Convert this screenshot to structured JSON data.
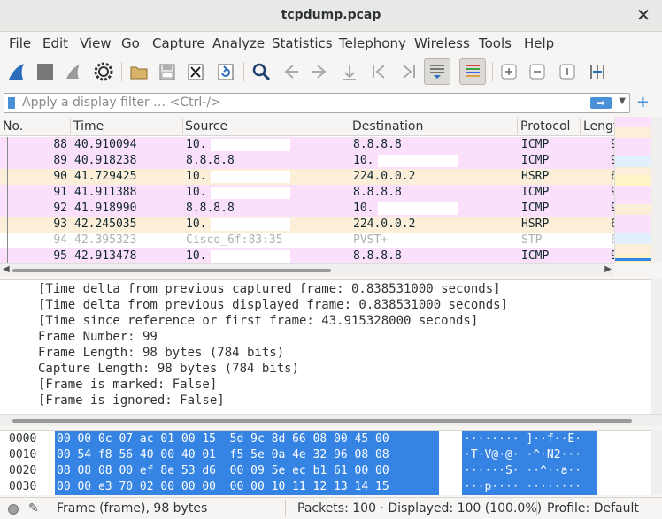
{
  "window": {
    "title": "tcpdump.pcap",
    "close": "✕"
  },
  "menu": [
    "File",
    "Edit",
    "View",
    "Go",
    "Capture",
    "Analyze",
    "Statistics",
    "Telephony",
    "Wireless",
    "Tools",
    "Help"
  ],
  "filter": {
    "placeholder": "Apply a display filter … <Ctrl-/>",
    "apply": "➡",
    "add": "+"
  },
  "columns": [
    "No.",
    "Time",
    "Source",
    "Destination",
    "Protocol",
    "Lengt"
  ],
  "packets": [
    {
      "no": "88",
      "time": "40.910094",
      "src": "10.",
      "dst": "8.8.8.8",
      "proto": "ICMP",
      "len": "9",
      "bg": "#fae0fa",
      "fg": "#12272e"
    },
    {
      "no": "89",
      "time": "40.918238",
      "src": "8.8.8.8",
      "dst": "10.",
      "proto": "ICMP",
      "len": "9",
      "bg": "#fae0fa",
      "fg": "#12272e"
    },
    {
      "no": "90",
      "time": "41.729425",
      "src": "10.",
      "dst": "224.0.0.2",
      "proto": "HSRP",
      "len": "6",
      "bg": "#fcefd9",
      "fg": "#12272e"
    },
    {
      "no": "91",
      "time": "41.911388",
      "src": "10.",
      "dst": "8.8.8.8",
      "proto": "ICMP",
      "len": "9",
      "bg": "#fae0fa",
      "fg": "#12272e"
    },
    {
      "no": "92",
      "time": "41.918990",
      "src": "8.8.8.8",
      "dst": "10.",
      "proto": "ICMP",
      "len": "9",
      "bg": "#fae0fa",
      "fg": "#12272e"
    },
    {
      "no": "93",
      "time": "42.245035",
      "src": "10.",
      "dst": "224.0.0.2",
      "proto": "HSRP",
      "len": "6",
      "bg": "#fcefd9",
      "fg": "#12272e"
    },
    {
      "no": "94",
      "time": "42.395323",
      "src": "Cisco_6f:83:35",
      "dst": "PVST+",
      "proto": "STP",
      "len": "6",
      "bg": "#ffffff",
      "fg": "#b0b0b0"
    },
    {
      "no": "95",
      "time": "42.913478",
      "src": "10.",
      "dst": "8.8.8.8",
      "proto": "ICMP",
      "len": "9",
      "bg": "#fae0fa",
      "fg": "#12272e"
    }
  ],
  "details": [
    "[Time delta from previous captured frame: 0.838531000 seconds]",
    "[Time delta from previous displayed frame: 0.838531000 seconds]",
    "[Time since reference or first frame: 43.915328000 seconds]",
    "Frame Number: 99",
    "Frame Length: 98 bytes (784 bits)",
    "Capture Length: 98 bytes (784 bits)",
    "[Frame is marked: False]",
    "[Frame is ignored: False]"
  ],
  "hex": [
    {
      "offset": "0000",
      "bytes": "00 00 0c 07 ac 01 00 15  5d 9c 8d 66 08 00 45 00",
      "ascii": "········ ]··f··E·"
    },
    {
      "offset": "0010",
      "bytes": "00 54 f8 56 40 00 40 01  f5 5e 0a 4e 32 96 08 08",
      "ascii": "·T·V@·@· ·^·N2···"
    },
    {
      "offset": "0020",
      "bytes": "08 08 08 00 ef 8e 53 d6  00 09 5e ec b1 61 00 00",
      "ascii": "······S· ··^··a··"
    },
    {
      "offset": "0030",
      "bytes": "00 00 e3 70 02 00 00 00  00 00 10 11 12 13 14 15",
      "ascii": "···p···· ········"
    }
  ],
  "status": {
    "frame": "Frame (frame), 98 bytes",
    "packets": "Packets: 100 · Displayed: 100 (100.0%)",
    "profile": "Profile: Default"
  },
  "toolbar_icons": [
    "shark-fin-icon",
    "stop-icon",
    "gear-icon",
    "folder-icon",
    "save-icon",
    "close-file-icon",
    "reload-icon",
    "search-icon",
    "back-icon",
    "forward-icon",
    "go-to-packet-icon",
    "first-packet-icon",
    "last-packet-icon",
    "autoscroll-icon",
    "colorize-icon",
    "zoom-in-icon",
    "zoom-out-icon",
    "normal-size-icon",
    "resize-columns-icon"
  ]
}
